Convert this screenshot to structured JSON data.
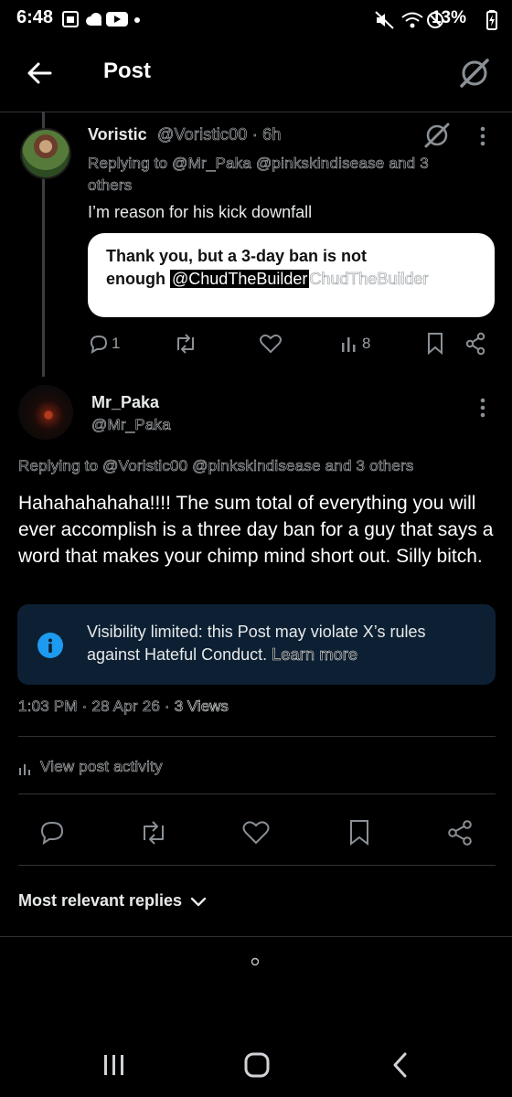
{
  "status_bar": {
    "time": "6:48",
    "battery": "13%",
    "icons": [
      "sim-icon",
      "cloud-icon",
      "youtube-icon",
      "dot-icon",
      "mute-icon",
      "wifi-icon",
      "no-sync-icon",
      "battery-icon"
    ]
  },
  "header": {
    "title": "Post",
    "back_icon": "arrow-left-icon",
    "grok_icon": "grok-icon"
  },
  "parent_post": {
    "name": "Voristic",
    "handle_time": "@Voristic00 · 6h",
    "replying_to": "Replying to @Mr_Paka @pinkskindisease and 3 others",
    "text": "I’m reason for his kick downfall",
    "quote_line1": "Thank you, but a 3-day ban is not",
    "quote_line2_start": "enough",
    "quote_mention": "@ChudTheBuilder",
    "quote_ghost": "ChudTheBuilder",
    "reply_count": "1",
    "view_count": "8"
  },
  "main_post": {
    "name": "Mr_Paka",
    "handle": "@Mr_Paka",
    "replying_to": "Replying to @Voristic00 @pinkskindisease and 3 others",
    "text": "Hahahahahaha!!!! The sum total of everything you will ever accomplish is a three day ban for a guy that says a word that makes your chimp mind short out. Silly bitch.",
    "notice_text": "Visibility limited: this Post may violate X’s rules against Hateful Conduct.",
    "notice_link": "Learn more",
    "timestamp": "1:03 PM · 28 Apr 26 · ",
    "views": "3 Views",
    "view_activity": "View post activity"
  },
  "replies": {
    "sort_label": "Most relevant replies"
  },
  "colors": {
    "background": "#000000",
    "accent_blue": "#1d9bf0",
    "notice_bg": "#0d2033"
  }
}
